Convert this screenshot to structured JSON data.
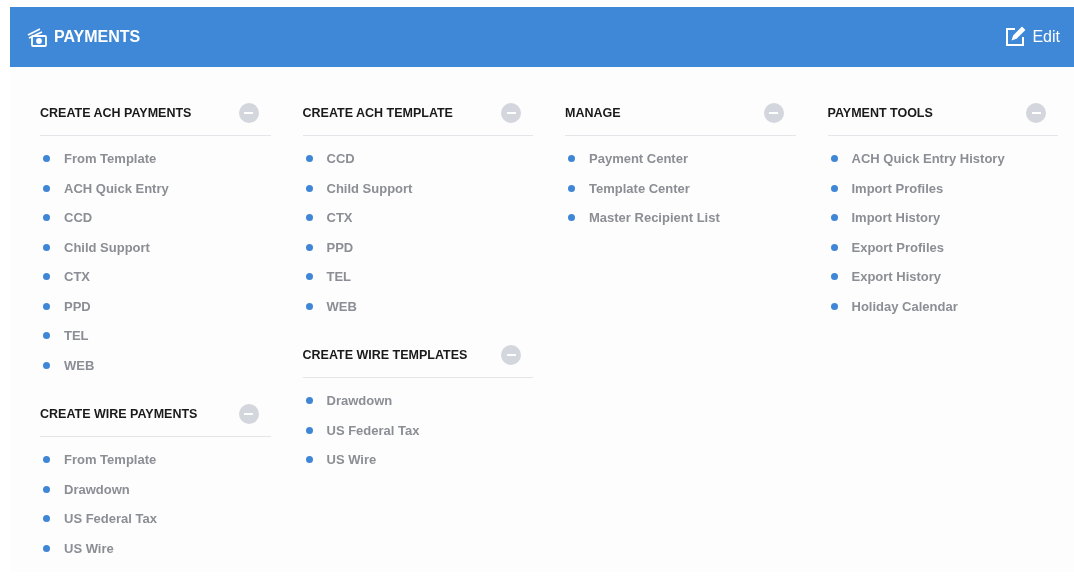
{
  "header": {
    "title": "PAYMENTS",
    "edit_label": "Edit"
  },
  "columns": [
    {
      "sections": [
        {
          "title": "CREATE ACH PAYMENTS",
          "items": [
            "From Template",
            "ACH Quick Entry",
            "CCD",
            "Child Support",
            "CTX",
            "PPD",
            "TEL",
            "WEB"
          ]
        },
        {
          "title": "CREATE WIRE PAYMENTS",
          "items": [
            "From Template",
            "Drawdown",
            "US Federal Tax",
            "US Wire"
          ]
        }
      ]
    },
    {
      "sections": [
        {
          "title": "CREATE ACH TEMPLATE",
          "items": [
            "CCD",
            "Child Support",
            "CTX",
            "PPD",
            "TEL",
            "WEB"
          ]
        },
        {
          "title": "CREATE WIRE TEMPLATES",
          "items": [
            "Drawdown",
            "US Federal Tax",
            "US Wire"
          ]
        }
      ]
    },
    {
      "sections": [
        {
          "title": "MANAGE",
          "items": [
            "Payment Center",
            "Template Center",
            "Master Recipient List"
          ]
        }
      ]
    },
    {
      "sections": [
        {
          "title": "PAYMENT TOOLS",
          "items": [
            "ACH Quick Entry History",
            "Import Profiles",
            "Import History",
            "Export Profiles",
            "Export History",
            "Holiday Calendar"
          ]
        }
      ]
    }
  ]
}
